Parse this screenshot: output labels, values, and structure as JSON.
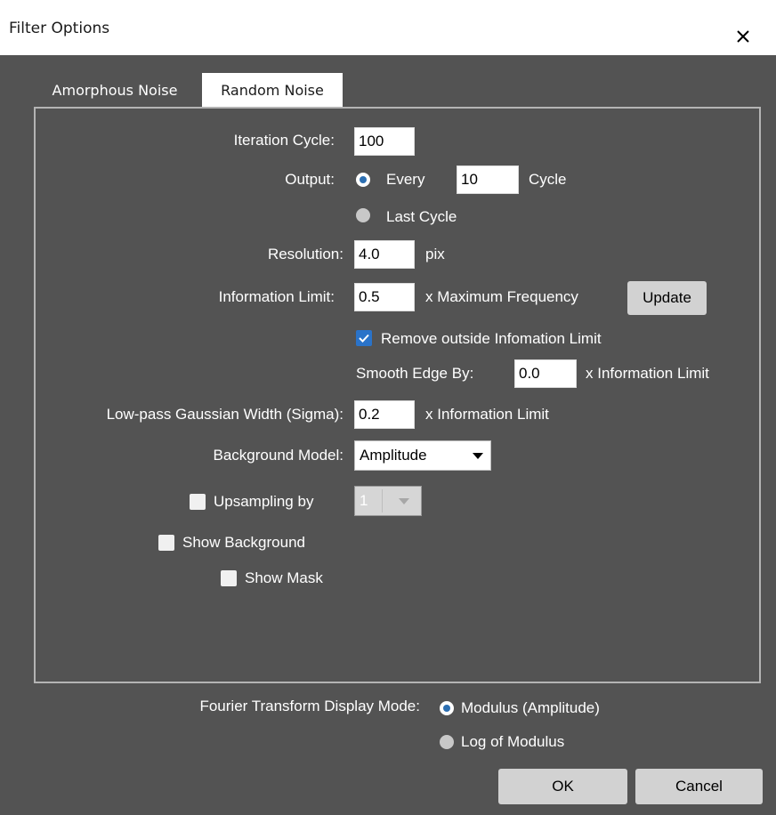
{
  "window": {
    "title": "Filter Options",
    "close_icon": "close-icon"
  },
  "tabs": [
    {
      "label": "Amorphous Noise",
      "active": false
    },
    {
      "label": "Random Noise",
      "active": true
    }
  ],
  "iteration": {
    "label": "Iteration Cycle:",
    "value": "100"
  },
  "output": {
    "label": "Output:",
    "every_label": "Every",
    "every_value": "10",
    "cycle_label": "Cycle",
    "last_cycle_label": "Last Cycle",
    "selected": "every"
  },
  "resolution": {
    "label": "Resolution:",
    "value": "4.0",
    "unit": "pix"
  },
  "information_limit": {
    "label": "Information Limit:",
    "value": "0.5",
    "unit": "x Maximum Frequency",
    "update_label": "Update"
  },
  "remove_outside": {
    "label": "Remove outside Infomation Limit",
    "checked": true
  },
  "smooth_edge": {
    "label": "Smooth Edge By:",
    "value": "0.0",
    "unit": "x Information Limit"
  },
  "lowpass": {
    "label": "Low-pass Gaussian Width (Sigma):",
    "value": "0.2",
    "unit": "x Information Limit"
  },
  "background_model": {
    "label": "Background Model:",
    "selected": "Amplitude"
  },
  "upsampling": {
    "label": "Upsampling by",
    "checked": false,
    "value": "1"
  },
  "show_background": {
    "label": "Show Background",
    "checked": false
  },
  "show_mask": {
    "label": "Show Mask",
    "checked": false
  },
  "fourier": {
    "label": "Fourier Transform Display Mode:",
    "options": [
      {
        "label": "Modulus (Amplitude)",
        "selected": true
      },
      {
        "label": "Log of Modulus",
        "selected": false
      }
    ]
  },
  "buttons": {
    "ok": "OK",
    "cancel": "Cancel"
  },
  "colors": {
    "dialog_bg": "#535353",
    "accent": "#2a73c9",
    "button_bg": "#d2d2d2",
    "text": "#ffffff"
  }
}
